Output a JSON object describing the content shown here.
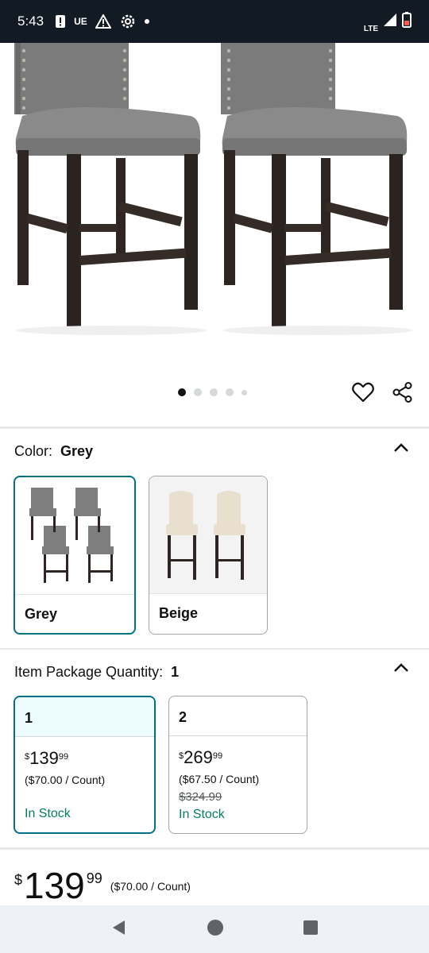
{
  "status_bar": {
    "time": "5:43",
    "carrier_icon_text": "UE",
    "network": "LTE",
    "icons": [
      "alert-icon",
      "warning-icon",
      "settings-icon",
      "dot-icon",
      "signal-icon",
      "battery-icon"
    ]
  },
  "gallery": {
    "image_count": 5,
    "active_index": 0
  },
  "color": {
    "label": "Color:",
    "selected": "Grey",
    "options": [
      {
        "name": "Grey",
        "selected": true
      },
      {
        "name": "Beige",
        "selected": false
      }
    ]
  },
  "quantity": {
    "label": "Item Package Quantity:",
    "selected": "1",
    "options": [
      {
        "qty": "1",
        "symbol": "$",
        "whole": "139",
        "fraction": "99",
        "per_count": "($70.00 / Count)",
        "was": "",
        "stock": "In Stock",
        "selected": true
      },
      {
        "qty": "2",
        "symbol": "$",
        "whole": "269",
        "fraction": "99",
        "per_count": "($67.50 / Count)",
        "was": "$324.99",
        "stock": "In Stock",
        "selected": false
      }
    ]
  },
  "price": {
    "symbol": "$",
    "whole": "139",
    "fraction": "99",
    "per_count": "($70.00 / Count)"
  },
  "colors": {
    "accent": "#007185",
    "in_stock": "#067d62",
    "status_bar": "#121a24"
  }
}
